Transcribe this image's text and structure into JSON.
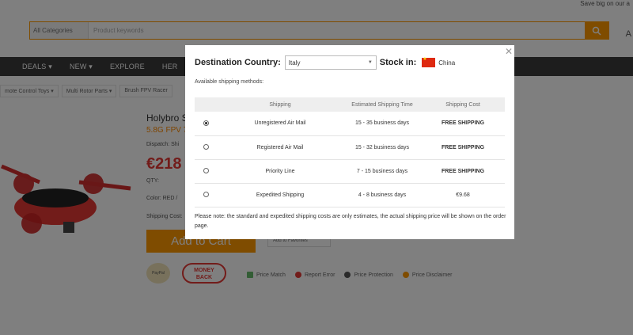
{
  "topbar": {
    "promo": "Save big on our a"
  },
  "search": {
    "category": "All Categories",
    "placeholder": "Product keywords"
  },
  "header": {
    "lang": "A"
  },
  "nav": {
    "items": [
      "",
      "DEALS ▾",
      "NEW ▾",
      "EXPLORE",
      "HER"
    ]
  },
  "breadcrumbs": [
    "mote Control Toys ▾",
    "Multi Rotor Parts ▾",
    "Brush FPV Racer"
  ],
  "product": {
    "title": "Holybro S",
    "subtitle": "5.8G FPV 7",
    "dispatch": "Dispatch:  Shi",
    "price": "€218",
    "qty": "QTY:",
    "color": "Color:  RED /",
    "shipping": "Shipping Cost:",
    "add_to_cart": "Add to Cart",
    "favorites": "Add to Favorites",
    "paypal": "PayPal",
    "money_back_1": "MONEY",
    "money_back_2": "BACK"
  },
  "guarantees": [
    "Price Match",
    "Report Error",
    "Price Protection",
    "Price Disclaimer"
  ],
  "modal": {
    "dest_label": "Destination Country:",
    "dest_value": "Italy",
    "stock_label": "Stock in:",
    "stock_country": "China",
    "available": "Available shipping methods:",
    "headers": [
      "Shipping",
      "Estimated Shipping Time",
      "Shipping Cost"
    ],
    "rows": [
      {
        "method": "Unregistered Air Mail",
        "time": "15 - 35 business days",
        "cost": "FREE SHIPPING",
        "selected": true
      },
      {
        "method": "Registered Air Mail",
        "time": "15 - 32 business days",
        "cost": "FREE SHIPPING",
        "selected": false
      },
      {
        "method": "Priority Line",
        "time": "7 - 15 business days",
        "cost": "FREE SHIPPING",
        "selected": false
      },
      {
        "method": "Expedited Shipping",
        "time": "4 - 8 business days",
        "cost": "€9.68",
        "selected": false
      }
    ],
    "note": "Please note: the standard and expedited shipping costs are only estimates, the actual shipping price will be shown on the order page.",
    "close": "✕"
  },
  "colors": {
    "accent": "#ff9800",
    "price": "#e53935",
    "free": "#cc0000",
    "nav": "#3a3a3a",
    "overlay": "rgba(0,0,0,0.5)"
  }
}
